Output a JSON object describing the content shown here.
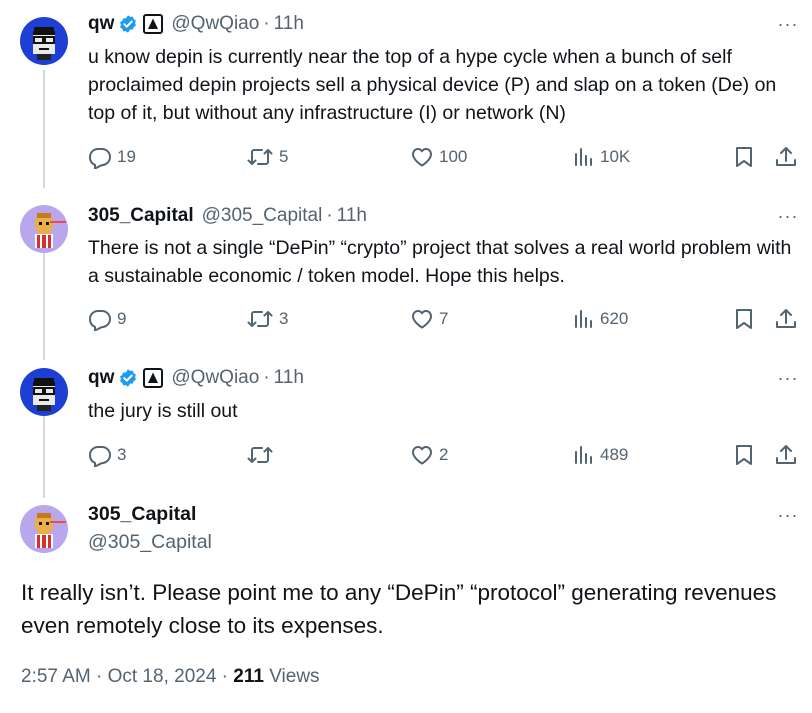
{
  "replies": [
    {
      "name": "qw",
      "handle": "@QwQiao",
      "time": "11h",
      "text": "u know depin is currently near the top of a hype cycle when a bunch of self proclaimed depin projects sell a physical device (P) and slap on a token (De) on top of it, but without any infrastructure (I) or network (N)",
      "replies_count": "19",
      "reposts_count": "5",
      "likes_count": "100",
      "views_count": "10K"
    },
    {
      "name": "305_Capital",
      "handle": "@305_Capital",
      "time": "11h",
      "text": "There is not a single “DePin” “crypto” project that solves a real world problem with a sustainable economic / token model. Hope this helps.",
      "replies_count": "9",
      "reposts_count": "3",
      "likes_count": "7",
      "views_count": "620"
    },
    {
      "name": "qw",
      "handle": "@QwQiao",
      "time": "11h",
      "text": "the jury is still out",
      "replies_count": "3",
      "reposts_count": "",
      "likes_count": "2",
      "views_count": "489"
    }
  ],
  "main_post": {
    "name": "305_Capital",
    "handle": "@305_Capital",
    "text": "It really isn’t. Please point me to any “DePin” “protocol” generating revenues even remotely close to its expenses.",
    "timestamp": "2:57 AM · Oct 18, 2024 · ",
    "views_count": "211",
    "views_label": " Views"
  },
  "separator": "·",
  "more_glyph": "···",
  "colors": {
    "text": "#0f1419",
    "secondary": "#536471",
    "verified": "#1d9bf0",
    "thread_line": "#cfd9de",
    "avatar_qw_bg": "#1d3fd6",
    "avatar_305_bg": "#b9a6ec"
  },
  "icons": [
    "verified-badge-icon",
    "affiliate-logo-icon",
    "more-icon",
    "reply-icon",
    "repost-icon",
    "like-icon",
    "views-icon",
    "bookmark-icon",
    "share-icon"
  ]
}
